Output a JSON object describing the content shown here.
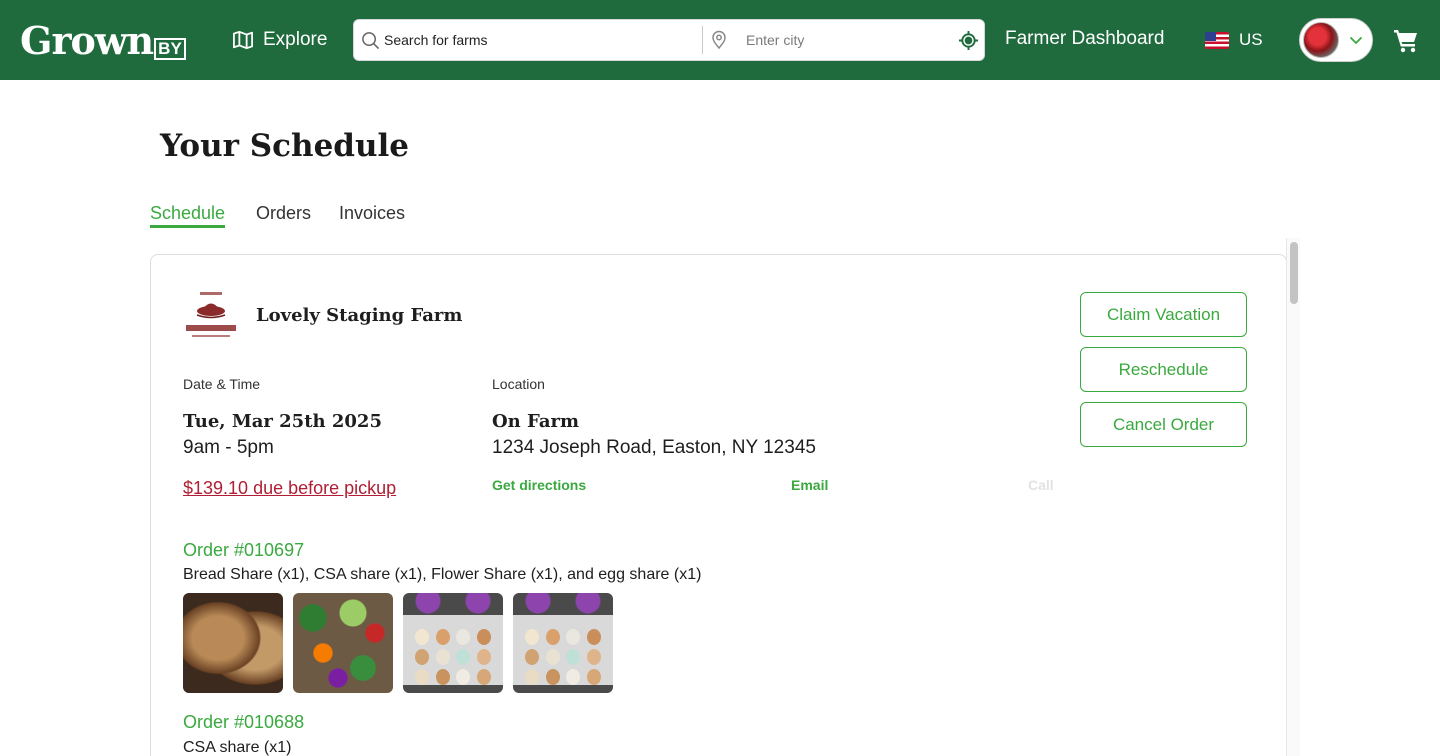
{
  "header": {
    "logo_main": "Grown",
    "logo_sub": "BY",
    "explore_label": "Explore",
    "search_placeholder": "Search for farms",
    "city_placeholder": "Enter city",
    "dashboard_label": "Farmer Dashboard",
    "region_label": "US",
    "brand_color": "#1f6b3e"
  },
  "page": {
    "title": "Your Schedule",
    "accent_color": "#3aa93f",
    "tabs": [
      {
        "label": "Schedule",
        "active": true
      },
      {
        "label": "Orders",
        "active": false
      },
      {
        "label": "Invoices",
        "active": false
      }
    ]
  },
  "pickup": {
    "farm_name": "Lovely Staging Farm",
    "date_label": "Date & Time",
    "date": "Tue, Mar 25th 2025",
    "time": "9am - 5pm",
    "location_label": "Location",
    "location_name": "On Farm",
    "address": "1234 Joseph Road, Easton, NY 12345",
    "due_text": "$139.10 due before pickup",
    "due_color": "#b01e35",
    "links": {
      "directions": "Get directions",
      "email": "Email",
      "call": "Call"
    },
    "buttons": {
      "claim_vacation": "Claim Vacation",
      "reschedule": "Reschedule",
      "cancel_order": "Cancel Order"
    }
  },
  "orders": [
    {
      "number": "Order #010697",
      "items": "Bread Share (x1), CSA share (x1), Flower Share (x1), and egg share (x1)",
      "thumbnails": [
        "bread-share-image",
        "csa-share-image",
        "flower-share-image",
        "egg-share-image"
      ]
    },
    {
      "number": "Order #010688",
      "items": "CSA share (x1)"
    }
  ]
}
